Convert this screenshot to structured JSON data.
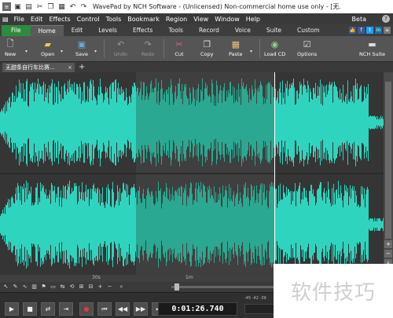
{
  "window": {
    "title": "WavePad by NCH Software - (Unlicensed) Non-commercial home use only - [无..."
  },
  "quick_access": [
    "app-icon",
    "folder-icon",
    "save-icon",
    "cut-icon",
    "copy-icon",
    "paste-icon",
    "undo-icon",
    "redo-icon"
  ],
  "menu": {
    "items": [
      "File",
      "Edit",
      "Effects",
      "Control",
      "Tools",
      "Bookmark",
      "Region",
      "View",
      "Window",
      "Help"
    ],
    "beta": "Beta"
  },
  "ribbon_tabs": [
    "File",
    "Home",
    "Edit",
    "Levels",
    "Effects",
    "Tools",
    "Record",
    "Voice",
    "Suite",
    "Custom"
  ],
  "ribbon_active": "Home",
  "toolbar": {
    "new": "New",
    "open": "Open",
    "save": "Save",
    "undo": "Undo",
    "redo": "Redo",
    "cut": "Cut",
    "copy": "Copy",
    "paste": "Paste",
    "load_cd": "Load CD",
    "options": "Options",
    "nch_suite": "NCH Suite"
  },
  "document_tab": {
    "name": "无甜条自行车比赛...",
    "close": "×",
    "add": "+"
  },
  "waveform": {
    "color": "#2fd4bf",
    "selection_color": "#2aa891",
    "background": "#353535",
    "selection_start": 0.355,
    "selection_end": 0.715
  },
  "timeline": {
    "labels": [
      "30s",
      "1m"
    ]
  },
  "transport": {
    "time": "0:01:26.740",
    "meter_scale": "-45  -42  -39"
  },
  "watermark": {
    "text": "软件技巧"
  },
  "colors": {
    "file_tab": "#2e8b3e",
    "record": "#e23b3b"
  }
}
